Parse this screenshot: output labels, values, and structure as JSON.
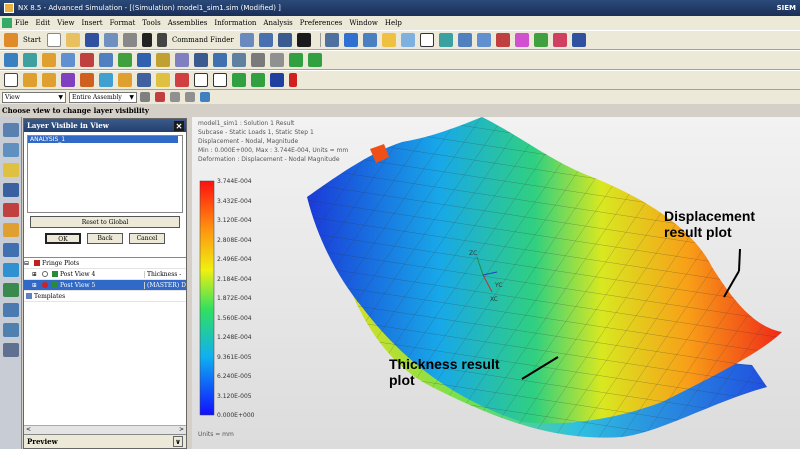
{
  "window": {
    "title": "NX 8.5 - Advanced Simulation - [(Simulation) model1_sim1.sim (Modified) ]",
    "brand": "SIEM"
  },
  "menu": [
    "File",
    "Edit",
    "View",
    "Insert",
    "Format",
    "Tools",
    "Assemblies",
    "Information",
    "Analysis",
    "Preferences",
    "Window",
    "Help"
  ],
  "toolbar": {
    "start_label": "Start",
    "command_finder_label": "Command Finder"
  },
  "selection_bar": {
    "filter": "View",
    "scope": "Entire Assembly"
  },
  "status": {
    "text": "Choose view to change layer visibility"
  },
  "layer_dialog": {
    "title": "Layer Visible in View",
    "layers": [
      "ANALYSIS_1"
    ],
    "reset_label": "Reset to Global",
    "ok_label": "OK",
    "back_label": "Back",
    "cancel_label": "Cancel"
  },
  "nav_tree": {
    "rows": [
      {
        "label": "Fringe Plots",
        "col2": ""
      },
      {
        "label": "Post View 4",
        "col2": "Thickness -"
      },
      {
        "label": "Post View 5",
        "col2": "(MASTER) Di"
      },
      {
        "label": "Templates",
        "col2": ""
      }
    ],
    "scroll_left": "<",
    "scroll_right": ">",
    "preview_label": "Preview"
  },
  "viewport": {
    "info": [
      "model1_sim1 : Solution 1 Result",
      "Subcase - Static Loads 1, Static Step 1",
      "Displacement - Nodal, Magnitude",
      "Min : 0.000E+000, Max : 3.744E-004, Units = mm",
      "Deformation : Displacement - Nodal Magnitude"
    ],
    "legend_values": [
      "3.744E-004",
      "3.432E-004",
      "3.120E-004",
      "2.808E-004",
      "2.496E-004",
      "2.184E-004",
      "1.872E-004",
      "1.560E-004",
      "1.248E-004",
      "9.361E-005",
      "6.240E-005",
      "3.120E-005",
      "0.000E+000"
    ],
    "units": "Units = mm",
    "callout_displacement": "Displacement result plot",
    "callout_thickness": "Thickness result plot",
    "axis_labels": [
      "ZC",
      "YC",
      "XC"
    ]
  },
  "colors": {
    "titlebar": "#1a2f57",
    "selection": "#3169c6",
    "legend_top": "#ff0000",
    "legend_bottom": "#0000ff"
  }
}
